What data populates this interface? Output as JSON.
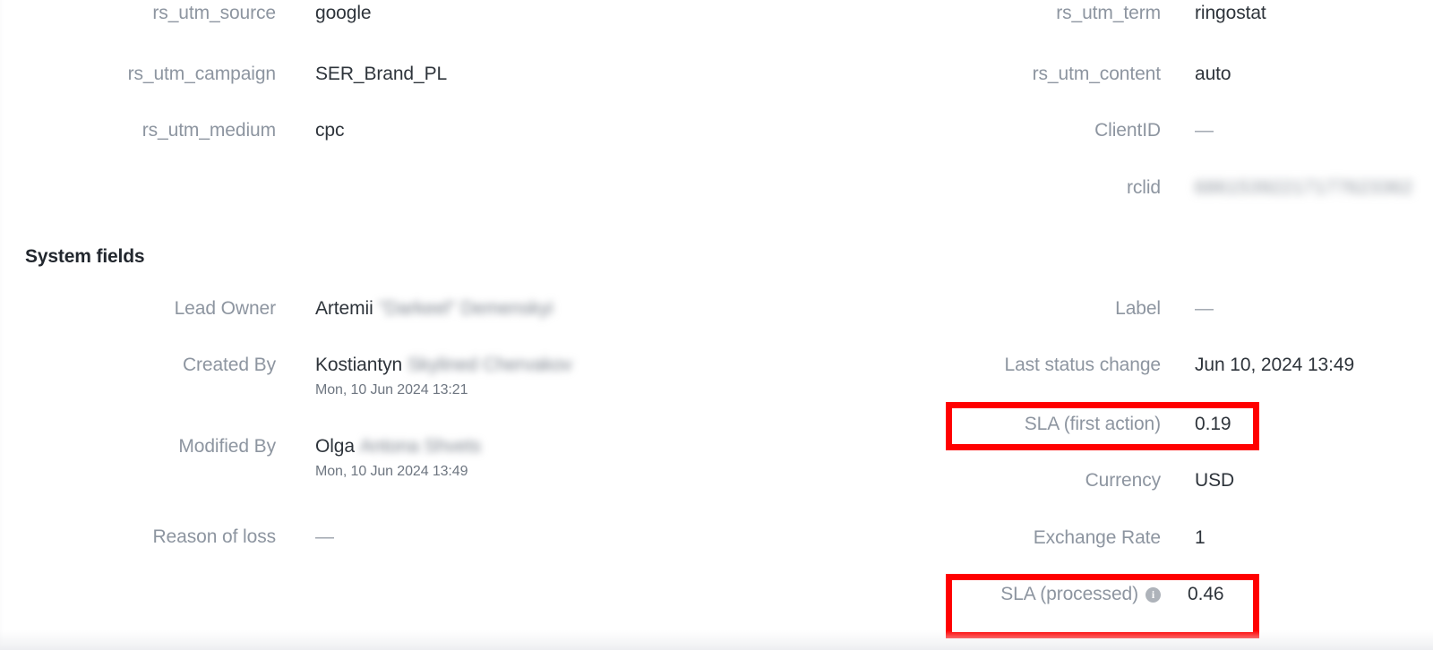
{
  "section": {
    "heading": "System fields"
  },
  "utm_left": [
    {
      "label": "rs_utm_source",
      "value": "google"
    },
    {
      "label": "rs_utm_campaign",
      "value": "SER_Brand_PL"
    },
    {
      "label": "rs_utm_medium",
      "value": "cpc"
    }
  ],
  "utm_right": [
    {
      "label": "rs_utm_term",
      "value": "ringostat"
    },
    {
      "label": "rs_utm_content",
      "value": "auto"
    },
    {
      "label": "ClientID",
      "value": "—"
    },
    {
      "label": "rclid",
      "value": "68615392217177623362",
      "redacted": true
    }
  ],
  "system_left": [
    {
      "label": "Lead Owner",
      "value_visible": "Artemii",
      "value_redacted": "\"Darkeel\" Demenskyi"
    },
    {
      "label": "Created By",
      "value_visible": "Kostiantyn",
      "value_redacted": "Skylined Chervakov",
      "sub": "Mon, 10 Jun 2024 13:21"
    },
    {
      "label": "Modified By",
      "value_visible": "Olga",
      "value_redacted": "Antona Shvets",
      "sub": "Mon, 10 Jun 2024 13:49"
    },
    {
      "label": "Reason of loss",
      "value_visible": "—"
    }
  ],
  "system_right": [
    {
      "label": "Label",
      "value": "—"
    },
    {
      "label": "Last status change",
      "value": "Jun 10, 2024 13:49"
    },
    {
      "label": "SLA (first action)",
      "value": "0.19",
      "highlighted": true
    },
    {
      "label": "Currency",
      "value": "USD"
    },
    {
      "label": "Exchange Rate",
      "value": "1"
    },
    {
      "label": "SLA (processed)",
      "value": "0.46",
      "highlighted": true,
      "info_icon": "info-icon"
    }
  ],
  "colors": {
    "label": "#8d95a0",
    "value": "#2e343b",
    "heading": "#22272e",
    "highlight": "#ff0000",
    "background": "#ffffff"
  }
}
